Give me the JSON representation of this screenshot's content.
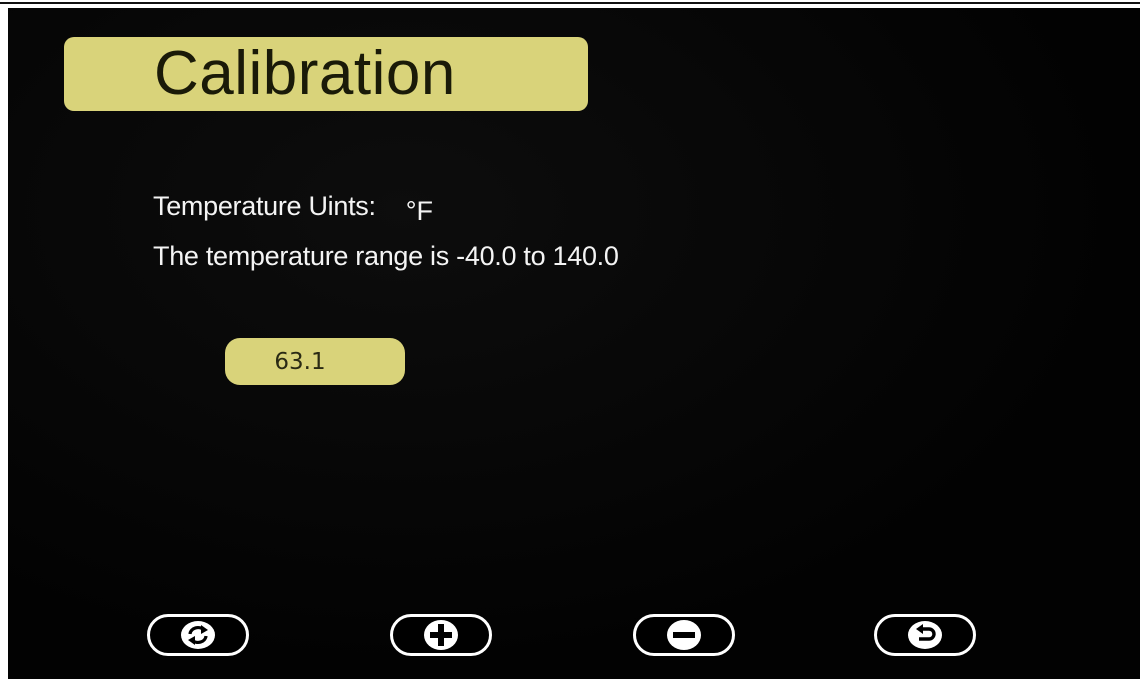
{
  "screen": {
    "title": "Calibration",
    "units_label": "Temperature Uints:",
    "units_value": "°F",
    "range_text": "The temperature range is -40.0 to 140.0",
    "current_value": "63.1"
  },
  "colors": {
    "accent": "#d9d37a",
    "background": "#030303",
    "text": "#f4f4f4"
  },
  "controls": [
    {
      "name": "refresh-button",
      "icon": "refresh-icon"
    },
    {
      "name": "increment-button",
      "icon": "plus-icon"
    },
    {
      "name": "decrement-button",
      "icon": "minus-icon"
    },
    {
      "name": "back-button",
      "icon": "return-icon"
    }
  ]
}
